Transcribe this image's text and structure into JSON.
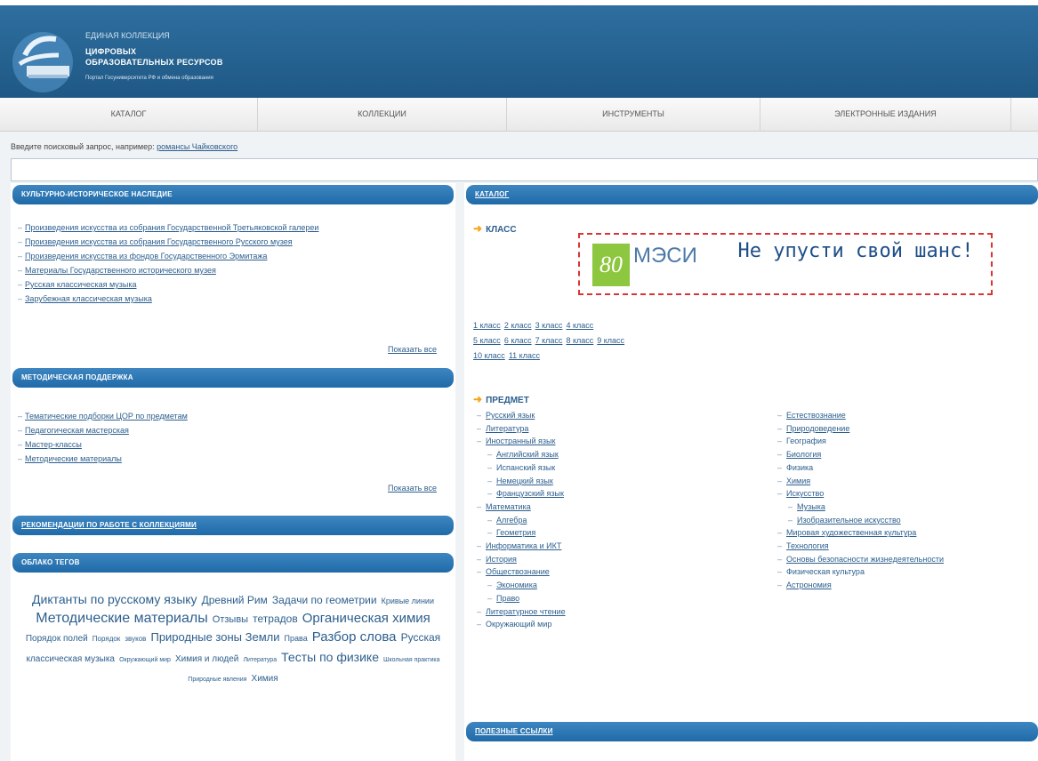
{
  "header": {
    "brand_line1": "ЕДИНАЯ КОЛЛЕКЦИЯ",
    "brand_line2": "ЦИФРОВЫХ",
    "brand_line3": "ОБРАЗОВАТЕЛЬНЫХ РЕСУРСОВ",
    "brand_line4": "Портал Госуниверситета РФ и обмена образования"
  },
  "nav": [
    {
      "label": "КАТАЛОГ"
    },
    {
      "label": "КОЛЛЕКЦИИ"
    },
    {
      "label": "ИНСТРУМЕНТЫ"
    },
    {
      "label": "ЭЛЕКТРОННЫЕ ИЗДАНИЯ"
    }
  ],
  "search": {
    "label": "Введите поисковый запрос, например:",
    "example": "романсы Чайковского",
    "value": ""
  },
  "left": {
    "heritage": {
      "title": "КУЛЬТУРНО-ИСТОРИЧЕСКОЕ НАСЛЕДИЕ",
      "items": [
        "Произведения искусства из собрания Государственной Третьяковской галереи",
        "Произведения искусства из собрания Государственного Русского музея",
        "Произведения искусства из фондов Государственного Эрмитажа",
        "Материалы Государственного исторического музея",
        "Русская классическая музыка",
        "Зарубежная классическая музыка"
      ],
      "more": "Показать все"
    },
    "method": {
      "title": "МЕТОДИЧЕСКАЯ ПОДДЕРЖКА",
      "items": [
        "Тематические подборки ЦОР по предметам",
        "Педагогическая мастерская",
        "Мастер-классы",
        "Методические материалы"
      ],
      "more": "Показать все"
    },
    "recommend": {
      "title": "РЕКОМЕНДАЦИИ ПО РАБОТЕ С КОЛЛЕКЦИЯМИ"
    },
    "tagcloud": {
      "title": "ОБЛАКО ТЕГОВ",
      "tags": [
        {
          "text": "Диктанты по русскому языку",
          "size": 14
        },
        {
          "text": "Древний Рим",
          "size": 12
        },
        {
          "text": "Задачи по геометрии",
          "size": 12
        },
        {
          "text": "Кривые линии",
          "size": 9
        },
        {
          "text": "Методические материалы",
          "size": 16
        },
        {
          "text": "Отзывы",
          "size": 11
        },
        {
          "text": "тетрадов",
          "size": 12
        },
        {
          "text": "Органическая химия",
          "size": 15
        },
        {
          "text": "Порядок полей",
          "size": 10
        },
        {
          "text": "Порядок",
          "size": 8
        },
        {
          "text": "звуков",
          "size": 8
        },
        {
          "text": "Природные зоны Земли",
          "size": 13
        },
        {
          "text": "Права",
          "size": 9
        },
        {
          "text": "Разбор слова",
          "size": 15
        },
        {
          "text": "Русская",
          "size": 12
        },
        {
          "text": "классическая музыка",
          "size": 10
        },
        {
          "text": "Окружающий мир",
          "size": 7
        },
        {
          "text": "Химия и людей",
          "size": 10
        },
        {
          "text": "Литература",
          "size": 7
        },
        {
          "text": "Тесты по физике",
          "size": 14
        },
        {
          "text": "Школьная практика",
          "size": 7
        },
        {
          "text": "Природные явления",
          "size": 7
        },
        {
          "text": "Химия",
          "size": 10
        }
      ]
    }
  },
  "right": {
    "catalog_title": "КАТАЛОГ",
    "class_title": "КЛАСС",
    "banner": {
      "badge": "80",
      "brand": "МЭСИ",
      "slogan": "Не упусти свой шанс!"
    },
    "classes_row1": [
      "1 класс",
      "2 класс",
      "3 класс",
      "4 класс"
    ],
    "classes_row2": [
      "5 класс",
      "6 класс",
      "7 класс",
      "8 класс",
      "9 класс"
    ],
    "classes_row3": [
      "10 класс",
      "11 класс"
    ],
    "subject_title": "ПРЕДМЕТ",
    "subjects_left": [
      {
        "text": "Русский язык",
        "sub": false,
        "link": true
      },
      {
        "text": "Литература",
        "sub": false,
        "link": true
      },
      {
        "text": "Иностранный язык",
        "sub": false,
        "link": true
      },
      {
        "text": "Английский язык",
        "sub": true,
        "link": true
      },
      {
        "text": "Испанский язык",
        "sub": true,
        "link": false
      },
      {
        "text": "Немецкий язык",
        "sub": true,
        "link": true
      },
      {
        "text": "Французский язык",
        "sub": true,
        "link": true
      },
      {
        "text": "Математика",
        "sub": false,
        "link": true
      },
      {
        "text": "Алгебра",
        "sub": true,
        "link": true
      },
      {
        "text": "Геометрия",
        "sub": true,
        "link": true
      },
      {
        "text": "Информатика и ИКТ",
        "sub": false,
        "link": true
      },
      {
        "text": "История",
        "sub": false,
        "link": true
      },
      {
        "text": "Обществознание",
        "sub": false,
        "link": true
      },
      {
        "text": "Экономика",
        "sub": true,
        "link": true
      },
      {
        "text": "Право",
        "sub": true,
        "link": true
      },
      {
        "text": "Литературное чтение",
        "sub": false,
        "link": true
      },
      {
        "text": "Окружающий мир",
        "sub": false,
        "link": false
      }
    ],
    "subjects_right": [
      {
        "text": "Естествознание",
        "sub": false,
        "link": true
      },
      {
        "text": "Природоведение",
        "sub": false,
        "link": true
      },
      {
        "text": "География",
        "sub": false,
        "link": false
      },
      {
        "text": "Биология",
        "sub": false,
        "link": true
      },
      {
        "text": "Физика",
        "sub": false,
        "link": false
      },
      {
        "text": "Химия",
        "sub": false,
        "link": true
      },
      {
        "text": "Искусство",
        "sub": false,
        "link": true
      },
      {
        "text": "Музыка",
        "sub": true,
        "link": true
      },
      {
        "text": "Изобразительное искусство",
        "sub": true,
        "link": true
      },
      {
        "text": "Мировая художественная культура",
        "sub": false,
        "link": true
      },
      {
        "text": "Технология",
        "sub": false,
        "link": true
      },
      {
        "text": "Основы безопасности жизнедеятельности",
        "sub": false,
        "link": true
      },
      {
        "text": "Физическая культура",
        "sub": false,
        "link": false
      },
      {
        "text": "Астрономия",
        "sub": false,
        "link": true
      }
    ],
    "links_title": "ПОЛЕЗНЫЕ ССЫЛКИ"
  },
  "colors": {
    "header_blue": "#1f5885",
    "panel_blue": "#1f6aa8",
    "link": "#2d5f8e",
    "accent_orange": "#f3a61a",
    "banner_green": "#8dc63f"
  }
}
